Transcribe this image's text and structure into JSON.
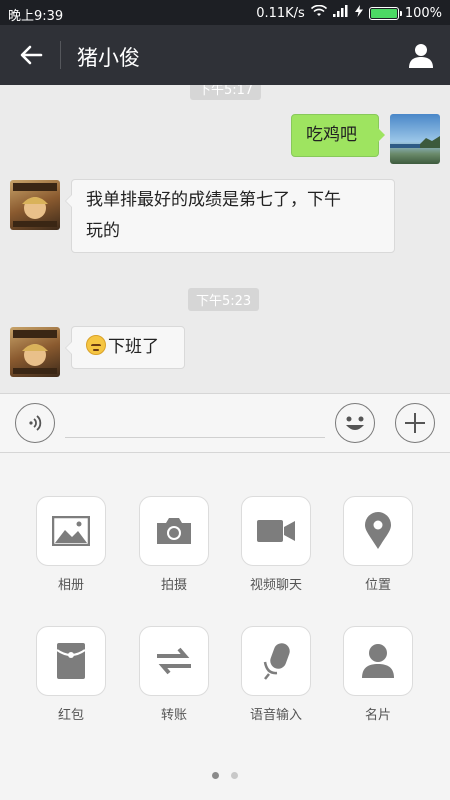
{
  "status_bar": {
    "time": "晚上9:39",
    "net_speed": "0.11K/s",
    "battery": "100%",
    "battery_level": 1.0
  },
  "header": {
    "title": "猪小俊"
  },
  "chat": {
    "timestamps": [
      "下午5:17",
      "下午5:23"
    ],
    "messages": [
      {
        "from": "self",
        "text": "吃鸡吧"
      },
      {
        "from": "contact",
        "line1": "我单排最好的成绩是第七了，下午",
        "line2": "玩的"
      },
      {
        "from": "contact",
        "text": "下班了",
        "emoji": "thinking-face"
      }
    ]
  },
  "input": {
    "placeholder": ""
  },
  "panel": {
    "items": [
      {
        "label": "相册",
        "icon": "album-icon"
      },
      {
        "label": "拍摄",
        "icon": "camera-icon"
      },
      {
        "label": "视频聊天",
        "icon": "video-icon"
      },
      {
        "label": "位置",
        "icon": "location-icon"
      },
      {
        "label": "红包",
        "icon": "red-packet-icon"
      },
      {
        "label": "转账",
        "icon": "transfer-icon"
      },
      {
        "label": "语音输入",
        "icon": "microphone-icon"
      },
      {
        "label": "名片",
        "icon": "contact-card-icon"
      }
    ],
    "pages": 2,
    "current_page": 1
  },
  "colors": {
    "header_bg": "#2f3137",
    "chat_bg": "#ebebeb",
    "outgoing_bubble": "#9ee460",
    "incoming_bubble": "#f7f7f7",
    "icon_gray": "#7d7d7d"
  }
}
